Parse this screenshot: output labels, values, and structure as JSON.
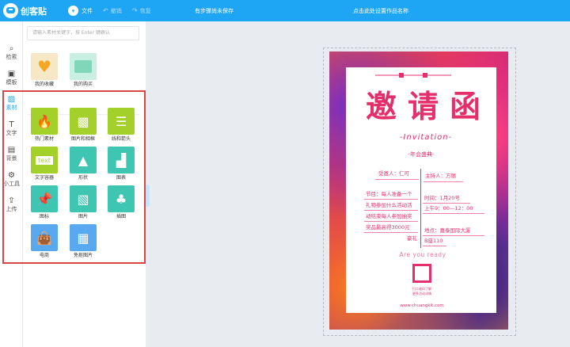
{
  "app": {
    "logo_text": "创客贴",
    "file_menu": "文件",
    "undo": "撤销",
    "redo": "恢复",
    "save_status": "有步骤尚未保存",
    "doc_title": "点击此处设置作品名称"
  },
  "rail": [
    {
      "label": "检索",
      "icon": "search-icon"
    },
    {
      "label": "模板",
      "icon": "template-icon"
    },
    {
      "label": "素材",
      "icon": "image-icon"
    },
    {
      "label": "文字",
      "icon": "text-icon"
    },
    {
      "label": "背景",
      "icon": "background-icon"
    },
    {
      "label": "小工具",
      "icon": "toolbox-icon"
    },
    {
      "label": "上传",
      "icon": "upload-icon"
    }
  ],
  "search": {
    "placeholder": "请输入素材关键字，按 Enter 键确认"
  },
  "my_items": [
    {
      "label": "我的收藏",
      "icon": "heart-icon",
      "color": "#f5a623"
    },
    {
      "label": "我的购买",
      "icon": "folder-icon",
      "color": "#7fd6b8"
    }
  ],
  "materials": [
    {
      "label": "热门素材",
      "icon": "flame-icon",
      "color": "#a3d12a"
    },
    {
      "label": "图片和相框",
      "icon": "photo-frame-icon",
      "color": "#a3d12a"
    },
    {
      "label": "线和箭头",
      "icon": "lines-icon",
      "color": "#a3d12a"
    },
    {
      "label": "文字容器",
      "icon": "text-container-icon",
      "color": "#a3d12a"
    },
    {
      "label": "形状",
      "icon": "shapes-icon",
      "color": "#3fc6b2"
    },
    {
      "label": "图表",
      "icon": "chart-icon",
      "color": "#3fc6b2"
    },
    {
      "label": "图标",
      "icon": "pin-icon",
      "color": "#3fc6b2"
    },
    {
      "label": "图片",
      "icon": "picture-icon",
      "color": "#3fc6b2"
    },
    {
      "label": "插图",
      "icon": "illustration-icon",
      "color": "#3fc6b2"
    },
    {
      "label": "电商",
      "icon": "shopping-bag-icon",
      "color": "#58a9f0"
    },
    {
      "label": "免抠图片",
      "icon": "cutout-icon",
      "color": "#58a9f0"
    }
  ],
  "poster": {
    "title_cn": [
      "邀",
      "请",
      "函"
    ],
    "title_en": "-Invitation-",
    "subtitle": "-年会盛典-",
    "invitee": "受邀人：仁可",
    "host": "主持人：方丽",
    "program_lines": [
      "节目：每人准备一个",
      "礼物参加什么活动活",
      "动结束每人参加抽奖",
      "奖品最高得3000元",
      "豪礼"
    ],
    "time_lines": [
      "时间：1月20号",
      "上午9：00—12：00"
    ],
    "place_lines": [
      "地点：嘉泰国际大厦",
      "B座110"
    ],
    "ready": "Are you ready",
    "qr_caption": [
      "扫二维码了解",
      "更多活动详情"
    ],
    "website": "www.chuangkit.com",
    "accent": "#e42f6a"
  },
  "colors": {
    "brand": "#1ea6f5",
    "highlight": "#d94545"
  }
}
